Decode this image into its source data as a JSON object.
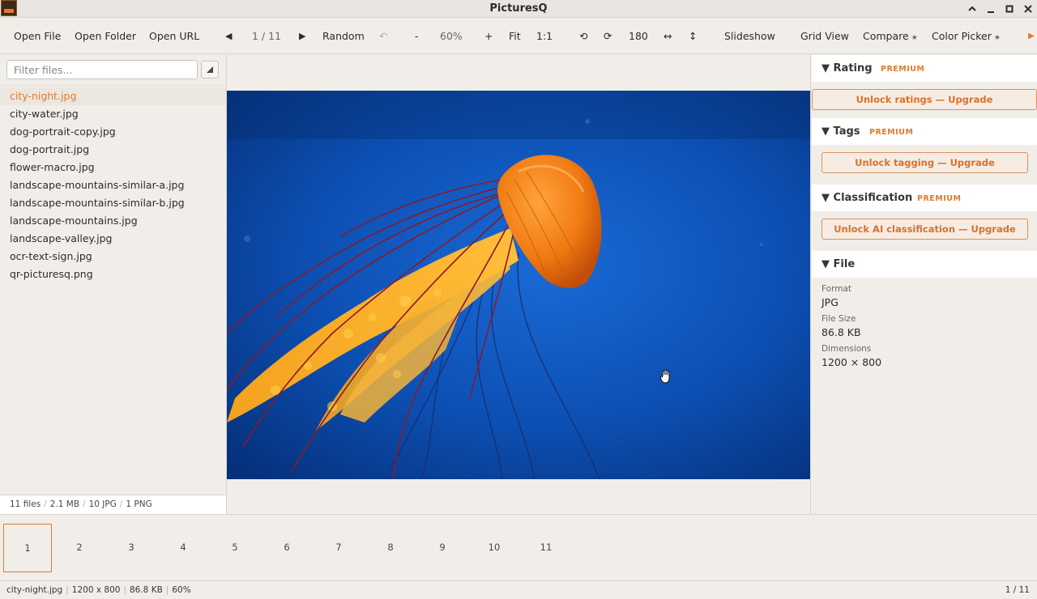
{
  "window": {
    "title": "PicturesQ"
  },
  "toolbar": {
    "open_file": "Open File",
    "open_folder": "Open Folder",
    "open_url": "Open URL",
    "prev_glyph": "◀",
    "position": "1 / 11",
    "next_glyph": "▶",
    "random": "Random",
    "undo_glyph": "↶",
    "zoom_out": "-",
    "zoom": "60%",
    "zoom_in": "+",
    "fit": "Fit",
    "one_to_one": "1:1",
    "rotate_left_glyph": "⟲",
    "rotate_right_glyph": "⟳",
    "rotation": "180",
    "flip_h_glyph": "↔",
    "flip_v_glyph": "↕",
    "slideshow": "Slideshow",
    "grid_view": "Grid View",
    "compare": "Compare",
    "color_picker": "Color Picker",
    "star_glyph": "★",
    "more_glyph": "▶"
  },
  "sidebar": {
    "filter_placeholder": "Filter files...",
    "files": [
      "city-night.jpg",
      "city-water.jpg",
      "dog-portrait-copy.jpg",
      "dog-portrait.jpg",
      "flower-macro.jpg",
      "landscape-mountains-similar-a.jpg",
      "landscape-mountains-similar-b.jpg",
      "landscape-mountains.jpg",
      "landscape-valley.jpg",
      "ocr-text-sign.jpg",
      "qr-picturesq.png"
    ],
    "selected_index": 0,
    "stats": {
      "files": "11 files",
      "size": "2.1 MB",
      "jpg": "10 JPG",
      "png": "1 PNG"
    }
  },
  "panel": {
    "rating": {
      "title": "Rating",
      "badge": "PREMIUM",
      "button": "Unlock ratings — Upgrade"
    },
    "tags": {
      "title": "Tags",
      "badge": "PREMIUM",
      "button": "Unlock tagging — Upgrade"
    },
    "classification": {
      "title": "Classification",
      "badge": "PREMIUM",
      "button": "Unlock AI classification — Upgrade"
    },
    "file": {
      "title": "File",
      "format_label": "Format",
      "format_value": "JPG",
      "size_label": "File Size",
      "size_value": "86.8 KB",
      "dims_label": "Dimensions",
      "dims_value": "1200 × 800"
    },
    "caret_glyph": "▼"
  },
  "thumbnails": [
    "1",
    "2",
    "3",
    "4",
    "5",
    "6",
    "7",
    "8",
    "9",
    "10",
    "11"
  ],
  "statusbar": {
    "filename": "city-night.jpg",
    "dimensions": "1200 x 800",
    "size": "86.8 KB",
    "zoom": "60%",
    "position": "1 / 11"
  },
  "colors": {
    "accent": "#e07a2a",
    "background": "#f1eeea",
    "photo_ocean": "#0a4aa8",
    "jellyfish": "#f07a1a"
  },
  "icons": {
    "app": "picturesq-app-icon",
    "minimize": "minimize-icon",
    "maximize": "maximize-icon",
    "close": "close-icon",
    "cursor": "hand-cursor-icon"
  }
}
